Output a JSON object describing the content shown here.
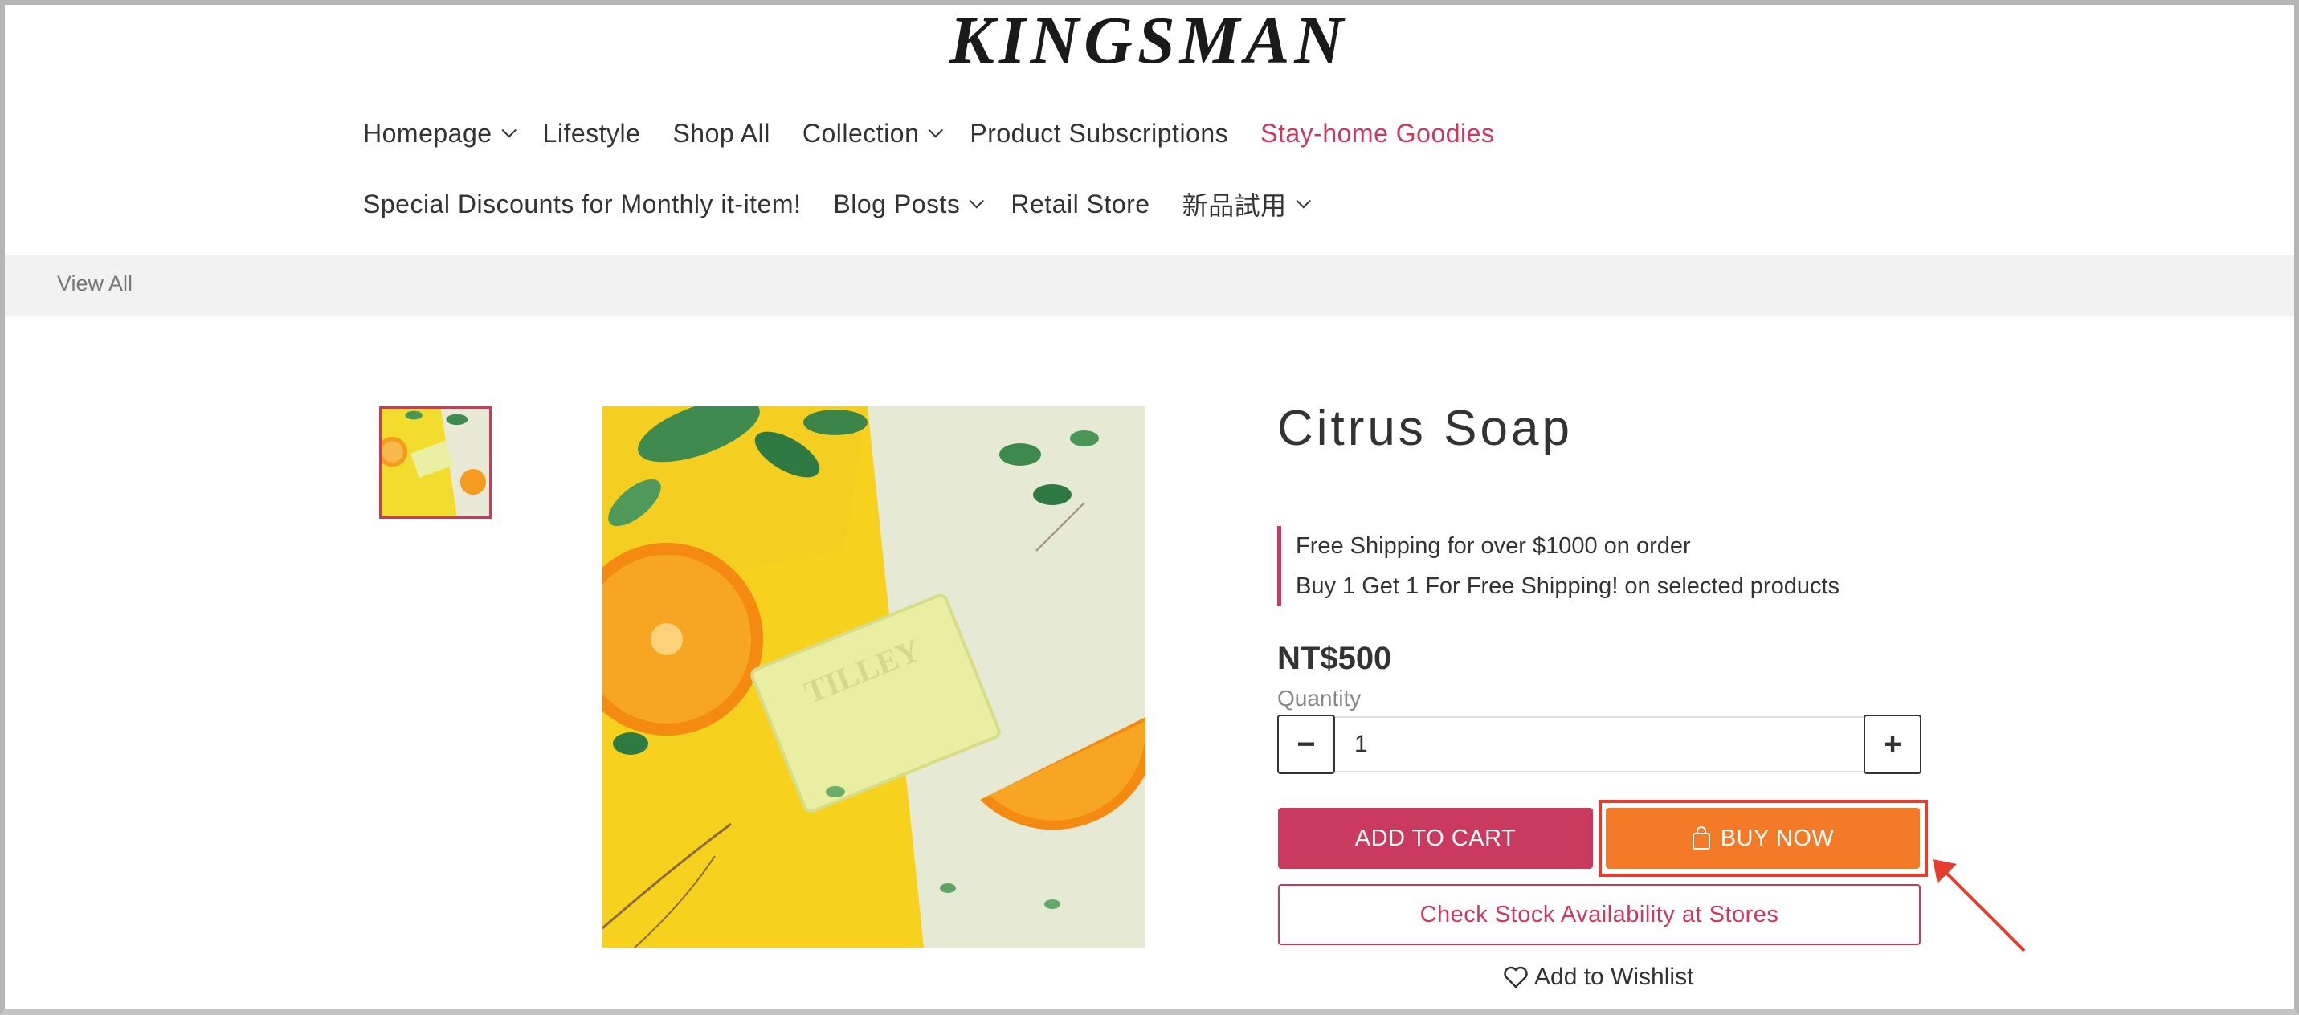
{
  "brand": {
    "logo_text": "KINGSMAN"
  },
  "nav": {
    "row1": [
      {
        "label": "Homepage",
        "dropdown": true
      },
      {
        "label": "Lifestyle",
        "dropdown": false
      },
      {
        "label": "Shop All",
        "dropdown": false
      },
      {
        "label": "Collection",
        "dropdown": true
      },
      {
        "label": "Product Subscriptions",
        "dropdown": false
      },
      {
        "label": "Stay-home Goodies",
        "dropdown": false
      }
    ],
    "row2": [
      {
        "label": "Special Discounts for Monthly it-item!",
        "dropdown": false
      },
      {
        "label": "Blog Posts",
        "dropdown": true
      },
      {
        "label": "Retail Store",
        "dropdown": false
      },
      {
        "label": "新品試用",
        "dropdown": true
      }
    ]
  },
  "breadcrumb": {
    "label": "View All"
  },
  "product": {
    "title": "Citrus Soap",
    "promotions": [
      "Free Shipping for over $1000 on order",
      "Buy 1 Get 1 For Free Shipping! on selected products"
    ],
    "price": "NT$500",
    "quantity_label": "Quantity",
    "quantity_value": "1"
  },
  "actions": {
    "add_to_cart": "ADD TO CART",
    "buy_now": "BUY NOW",
    "check_stock": "Check Stock Availability at Stores",
    "wishlist": "Add to Wishlist"
  },
  "colors": {
    "accent": "#c93a5e",
    "buy_now": "#f47a27",
    "highlight": "#e53c2e"
  }
}
